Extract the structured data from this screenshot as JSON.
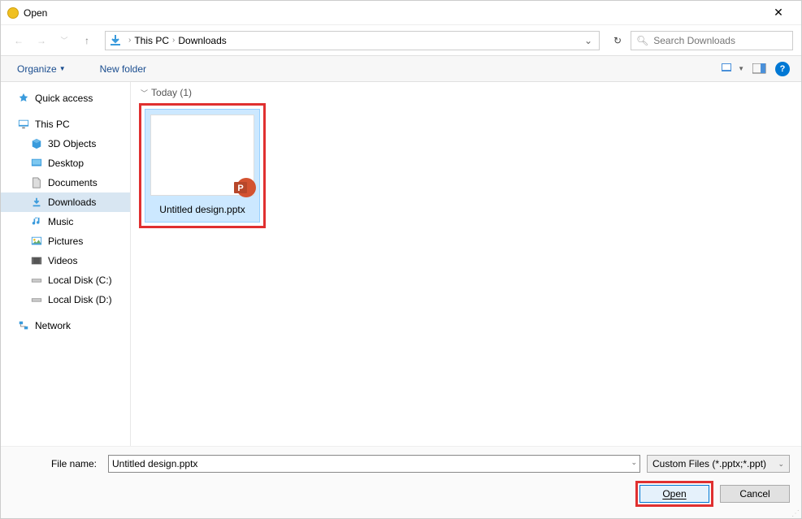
{
  "window": {
    "title": "Open",
    "close_label": "✕"
  },
  "nav": {
    "breadcrumb": [
      "This PC",
      "Downloads"
    ],
    "search_placeholder": "Search Downloads"
  },
  "toolbar": {
    "organize": "Organize",
    "newfolder": "New folder"
  },
  "sidebar": {
    "quick_access": "Quick access",
    "this_pc": "This PC",
    "objects_3d": "3D Objects",
    "desktop": "Desktop",
    "documents": "Documents",
    "downloads": "Downloads",
    "music": "Music",
    "pictures": "Pictures",
    "videos": "Videos",
    "disk_c": "Local Disk (C:)",
    "disk_d": "Local Disk (D:)",
    "network": "Network"
  },
  "content": {
    "group": "Today (1)",
    "file_name": "Untitled design.pptx"
  },
  "footer": {
    "filename_label": "File name:",
    "filename_value": "Untitled design.pptx",
    "filter": "Custom Files (*.pptx;*.ppt)",
    "open": "Open",
    "cancel": "Cancel"
  }
}
